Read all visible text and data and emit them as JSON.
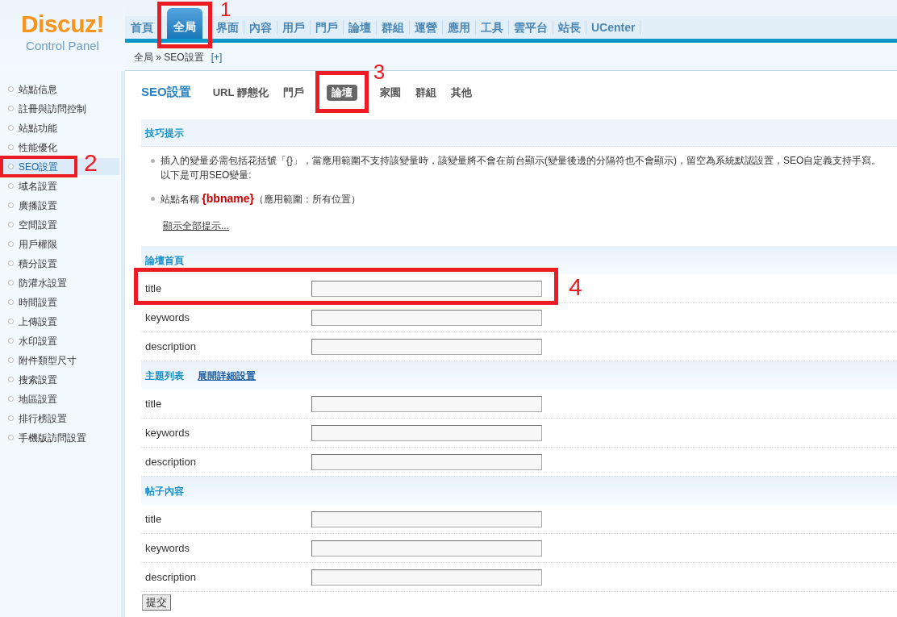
{
  "logo": {
    "name": "Discuz!",
    "subtitle": "Control Panel"
  },
  "top_nav": [
    {
      "label": "首頁",
      "selected": false
    },
    {
      "label": "全局",
      "selected": true,
      "annotation": "1"
    },
    {
      "label": "界面",
      "selected": false
    },
    {
      "label": "內容",
      "selected": false
    },
    {
      "label": "用戶",
      "selected": false
    },
    {
      "label": "門戶",
      "selected": false
    },
    {
      "label": "論壇",
      "selected": false
    },
    {
      "label": "群組",
      "selected": false
    },
    {
      "label": "運營",
      "selected": false
    },
    {
      "label": "應用",
      "selected": false
    },
    {
      "label": "工具",
      "selected": false
    },
    {
      "label": "雲平台",
      "selected": false
    },
    {
      "label": "站長",
      "selected": false
    },
    {
      "label": "UCenter",
      "selected": false
    }
  ],
  "breadcrumb": {
    "path": "全局 » SEO設置",
    "add": "[+]"
  },
  "sidebar": {
    "items": [
      {
        "label": "站點信息",
        "selected": false
      },
      {
        "label": "註冊與訪問控制",
        "selected": false
      },
      {
        "label": "站點功能",
        "selected": false
      },
      {
        "label": "性能優化",
        "selected": false
      },
      {
        "label": "SEO設置",
        "selected": true,
        "annotation": "2"
      },
      {
        "label": "域名設置",
        "selected": false
      },
      {
        "label": "廣播設置",
        "selected": false
      },
      {
        "label": "空間設置",
        "selected": false
      },
      {
        "label": "用戶權限",
        "selected": false
      },
      {
        "label": "積分設置",
        "selected": false
      },
      {
        "label": "防灌水設置",
        "selected": false
      },
      {
        "label": "時間設置",
        "selected": false
      },
      {
        "label": "上傳設置",
        "selected": false
      },
      {
        "label": "水印設置",
        "selected": false
      },
      {
        "label": "附件類型尺寸",
        "selected": false
      },
      {
        "label": "搜索設置",
        "selected": false
      },
      {
        "label": "地區設置",
        "selected": false
      },
      {
        "label": "排行榜設置",
        "selected": false
      },
      {
        "label": "手機版訪問設置",
        "selected": false
      }
    ]
  },
  "page": {
    "title": "SEO設置",
    "tabs": [
      {
        "label": "URL 靜態化",
        "selected": false
      },
      {
        "label": "門戶",
        "selected": false
      },
      {
        "label": "論壇",
        "selected": true,
        "annotation": "3"
      },
      {
        "label": "家園",
        "selected": false
      },
      {
        "label": "群組",
        "selected": false
      },
      {
        "label": "其他",
        "selected": false
      }
    ]
  },
  "tips": {
    "title": "技巧提示",
    "items": [
      {
        "kind": "text",
        "lines": [
          "插入的變量必需包括花括號「{}」，當應用範圍不支持該變量時，該變量將不會在前台顯示(變量後邊的分隔符也不會顯示)，留空為系統默認設置，SEO自定義支持手寫。",
          "以下是可用SEO變量:"
        ]
      },
      {
        "kind": "variable",
        "label": "站點名稱",
        "variable": "{bbname}",
        "scope": "（應用範圍：所有位置）"
      }
    ],
    "more_link": "顯示全部提示..."
  },
  "sections": [
    {
      "title": "論壇首頁",
      "fields": [
        {
          "label": "title",
          "annotation": "4"
        },
        {
          "label": "keywords"
        },
        {
          "label": "description"
        }
      ]
    },
    {
      "title": "主題列表",
      "link": "展開詳細設置",
      "fields": [
        {
          "label": "title"
        },
        {
          "label": "keywords"
        },
        {
          "label": "description"
        }
      ]
    },
    {
      "title": "帖子內容",
      "fields": [
        {
          "label": "title"
        },
        {
          "label": "keywords"
        },
        {
          "label": "description"
        }
      ]
    }
  ],
  "submit": "提交"
}
